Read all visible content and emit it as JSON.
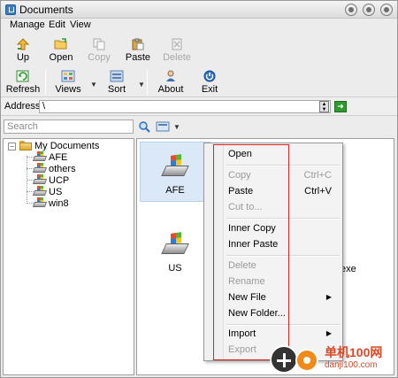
{
  "window": {
    "title": "Documents"
  },
  "menubar": [
    "Manage",
    "Edit",
    "View"
  ],
  "toolbar": {
    "up": "Up",
    "open": "Open",
    "copy": "Copy",
    "paste": "Paste",
    "delete": "Delete",
    "refresh": "Refresh",
    "views": "Views",
    "sort": "Sort",
    "about": "About",
    "exit": "Exit"
  },
  "address": {
    "label": "Address",
    "value": "\\"
  },
  "search": {
    "placeholder": "Search"
  },
  "tree": {
    "root": "My Documents",
    "children": [
      "AFE",
      "others",
      "UCP",
      "US",
      "win8"
    ]
  },
  "files": {
    "items": [
      "AFE",
      "US"
    ],
    "partial_label": "exe"
  },
  "context_menu": {
    "open": "Open",
    "copy": "Copy",
    "copy_shortcut": "Ctrl+C",
    "paste": "Paste",
    "paste_shortcut": "Ctrl+V",
    "cut_to": "Cut to...",
    "inner_copy": "Inner Copy",
    "inner_paste": "Inner Paste",
    "delete": "Delete",
    "rename": "Rename",
    "new_file": "New File",
    "new_folder": "New Folder...",
    "import": "Import",
    "export": "Export"
  },
  "watermark": {
    "title": "单机100网",
    "subtitle": "danji100.com"
  },
  "colors": {
    "highlight": "#e0201f",
    "selection": "#dbe8f7",
    "accent": "#3a7fc4"
  }
}
